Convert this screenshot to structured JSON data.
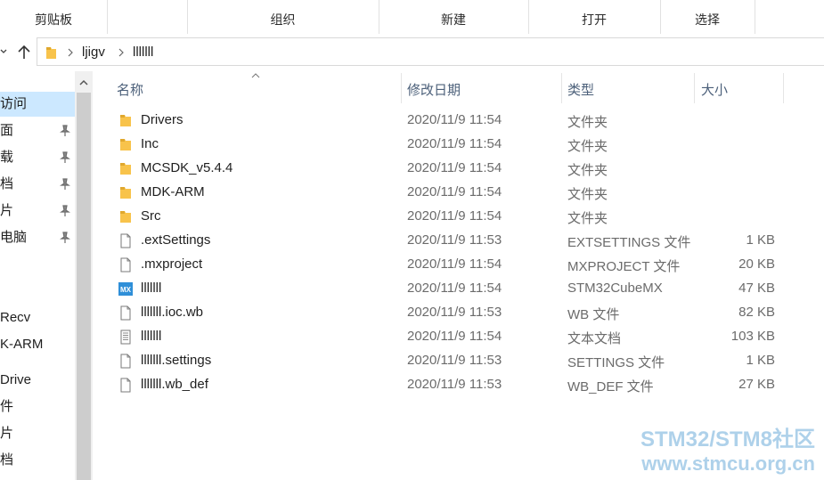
{
  "ribbon": {
    "groups": [
      "剪贴板",
      "组织",
      "新建",
      "打开",
      "选择"
    ]
  },
  "address": {
    "crumbs": [
      "ljigv",
      "lllllll"
    ]
  },
  "nav_pane": {
    "items": [
      "访问",
      "面",
      "载",
      "档",
      "片",
      "电脑",
      "",
      "",
      "Recv",
      "K-ARM",
      "Drive",
      "件",
      "片",
      "档"
    ]
  },
  "columns": {
    "name": "名称",
    "date": "修改日期",
    "type": "类型",
    "size": "大小"
  },
  "files": [
    {
      "name": "Drivers",
      "date": "2020/11/9 11:54",
      "type": "文件夹",
      "size": "",
      "icon": "folder-icon"
    },
    {
      "name": "Inc",
      "date": "2020/11/9 11:54",
      "type": "文件夹",
      "size": "",
      "icon": "folder-icon"
    },
    {
      "name": "MCSDK_v5.4.4",
      "date": "2020/11/9 11:54",
      "type": "文件夹",
      "size": "",
      "icon": "folder-icon"
    },
    {
      "name": "MDK-ARM",
      "date": "2020/11/9 11:54",
      "type": "文件夹",
      "size": "",
      "icon": "folder-icon"
    },
    {
      "name": "Src",
      "date": "2020/11/9 11:54",
      "type": "文件夹",
      "size": "",
      "icon": "folder-icon"
    },
    {
      "name": ".extSettings",
      "date": "2020/11/9 11:53",
      "type": "EXTSETTINGS 文件",
      "size": "1 KB",
      "icon": "file-icon"
    },
    {
      "name": ".mxproject",
      "date": "2020/11/9 11:54",
      "type": "MXPROJECT 文件",
      "size": "20 KB",
      "icon": "file-icon"
    },
    {
      "name": "lllllll",
      "date": "2020/11/9 11:54",
      "type": "STM32CubeMX",
      "size": "47 KB",
      "icon": "cubemx-icon"
    },
    {
      "name": "lllllll.ioc.wb",
      "date": "2020/11/9 11:53",
      "type": "WB 文件",
      "size": "82 KB",
      "icon": "file-icon"
    },
    {
      "name": "lllllll",
      "date": "2020/11/9 11:54",
      "type": "文本文档",
      "size": "103 KB",
      "icon": "text-file-icon"
    },
    {
      "name": "lllllll.settings",
      "date": "2020/11/9 11:53",
      "type": "SETTINGS 文件",
      "size": "1 KB",
      "icon": "file-icon"
    },
    {
      "name": "lllllll.wb_def",
      "date": "2020/11/9 11:53",
      "type": "WB_DEF 文件",
      "size": "27 KB",
      "icon": "file-icon"
    }
  ],
  "watermark": {
    "line1": "STM32/STM8社区",
    "line2": "www.stmcu.org.cn"
  },
  "colors": {
    "selection": "#cce8ff",
    "folder": "#f8c34b",
    "header_text": "#4c607a",
    "watermark": "#aed1ea"
  }
}
